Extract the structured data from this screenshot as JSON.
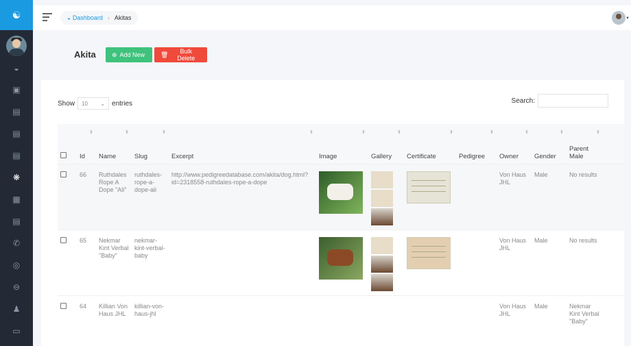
{
  "breadcrumb": {
    "home": "Dashboard",
    "current": "Akitas"
  },
  "page": {
    "title": "Akita",
    "add_label": "Add New",
    "bulk_delete_label": "Bulk Delete"
  },
  "table_controls": {
    "show": "Show",
    "entries_value": "10",
    "entries": "entries",
    "search_label": "Search:"
  },
  "colors": {
    "accent": "#1a9ae0",
    "success": "#3ec27c",
    "danger": "#f04a3b",
    "sidebar": "#232a36"
  },
  "columns": [
    "Id",
    "Name",
    "Slug",
    "Excerpt",
    "Image",
    "Gallery",
    "Certificate",
    "Pedigree",
    "Owner",
    "Gender",
    "Parent Male"
  ],
  "rows": [
    {
      "id": "66",
      "name": "Ruthdales Rope A Dope \"Ali\"",
      "slug": "ruthdales-rope-a-dope-ali",
      "excerpt": "http://www.pedigreedatabase.com/akita/dog.html?id=2318558-ruthdales-rope-a-dope",
      "pedigree": "",
      "owner": "Von Haus JHL",
      "gender": "Male",
      "parent_male": "No results"
    },
    {
      "id": "65",
      "name": "Nekmar Kint Verbal \"Baby\"",
      "slug": "nekmar-kint-verbal-baby",
      "excerpt": "",
      "pedigree": "",
      "owner": "Von Haus JHL",
      "gender": "Male",
      "parent_male": "No results"
    },
    {
      "id": "64",
      "name": "Killian Von Haus JHL",
      "slug": "killian-von-haus-jhl",
      "excerpt": "",
      "pedigree": "",
      "owner": "Von Haus JHL",
      "gender": "Male",
      "parent_male": "Nekmar Kint Verbal \"Baby\""
    }
  ]
}
